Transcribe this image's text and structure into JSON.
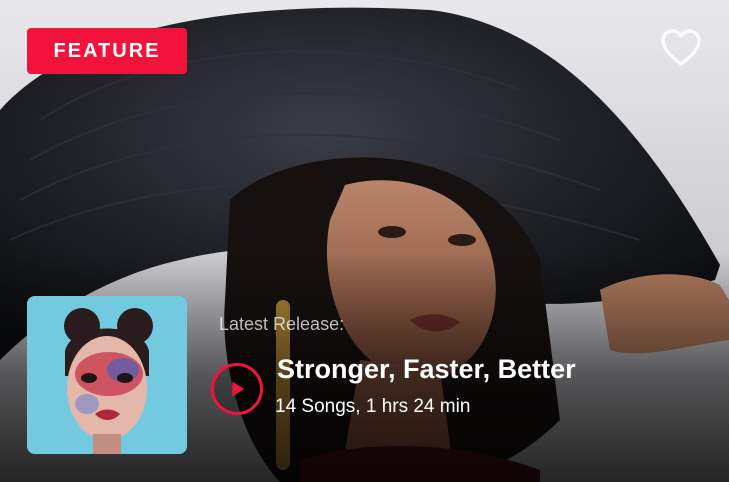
{
  "feature": {
    "badge_label": "FEATURE",
    "badge_color": "#f3123c"
  },
  "actions": {
    "favorite_icon": "heart-outline-icon",
    "play_icon": "play-icon"
  },
  "release": {
    "label": "Latest Release:",
    "title": "Stronger, Faster, Better",
    "meta": "14 Songs, 1 hrs 24 min",
    "accent_color": "#f3123c"
  }
}
